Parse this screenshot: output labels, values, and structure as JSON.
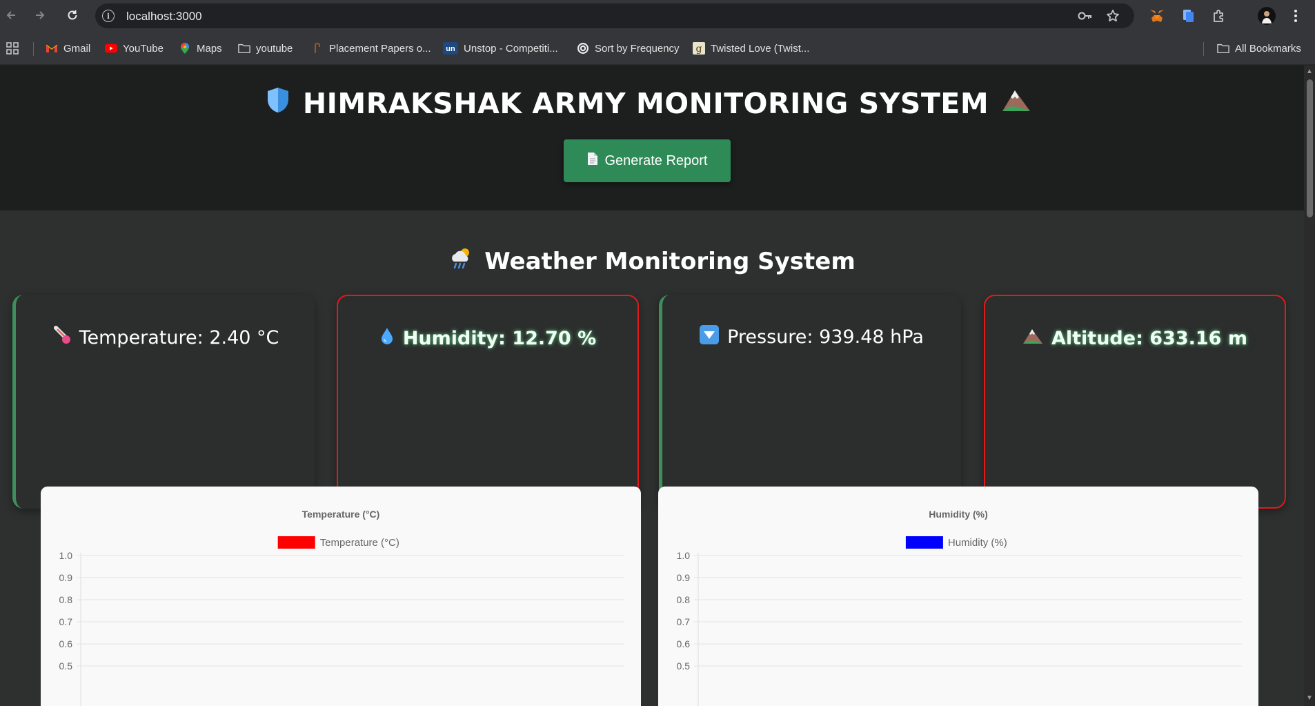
{
  "browser": {
    "url": "localhost:3000",
    "bookmarks": [
      {
        "label": "Gmail",
        "icon": "gmail-icon"
      },
      {
        "label": "YouTube",
        "icon": "youtube-icon"
      },
      {
        "label": "Maps",
        "icon": "maps-icon"
      },
      {
        "label": "youtube",
        "icon": "folder-icon"
      },
      {
        "label": "Placement Papers o...",
        "icon": "placement-papers-icon"
      },
      {
        "label": "Unstop - Competiti...",
        "icon": "unstop-icon"
      },
      {
        "label": "Sort by Frequency",
        "icon": "leetcode-icon"
      },
      {
        "label": "Twisted Love (Twist...",
        "icon": "goodreads-icon"
      }
    ],
    "all_bookmarks": "All Bookmarks"
  },
  "header": {
    "title": "HIMRAKSHAK ARMY MONITORING SYSTEM",
    "report_button": "Generate Report"
  },
  "section": {
    "title": "Weather Monitoring System"
  },
  "cards": [
    {
      "label": "Temperature: 2.40 °C",
      "status": "normal",
      "icon": "thermometer-icon"
    },
    {
      "label": "Humidity: 12.70 %",
      "status": "alert",
      "icon": "droplet-icon"
    },
    {
      "label": "Pressure: 939.48 hPa",
      "status": "normal",
      "icon": "down-arrow-icon"
    },
    {
      "label": "Altitude: 633.16 m",
      "status": "alert",
      "icon": "mountain-icon"
    }
  ],
  "colors": {
    "normal_border": "#3f8f5c",
    "alert_border": "#e21a1a",
    "button_bg": "#2e8b57"
  },
  "chart_data": [
    {
      "type": "line",
      "title": "Temperature (°C)",
      "series": [
        {
          "name": "Temperature (°C)",
          "color": "#ff0000",
          "values": []
        }
      ],
      "y_ticks": [
        "1.0",
        "0.9",
        "0.8",
        "0.7",
        "0.6",
        "0.5"
      ],
      "ylim": [
        0,
        1.0
      ],
      "grid": true,
      "legend": "top"
    },
    {
      "type": "line",
      "title": "Humidity (%)",
      "series": [
        {
          "name": "Humidity (%)",
          "color": "#0000ff",
          "values": []
        }
      ],
      "y_ticks": [
        "1.0",
        "0.9",
        "0.8",
        "0.7",
        "0.6",
        "0.5"
      ],
      "ylim": [
        0,
        1.0
      ],
      "grid": true,
      "legend": "top"
    }
  ]
}
